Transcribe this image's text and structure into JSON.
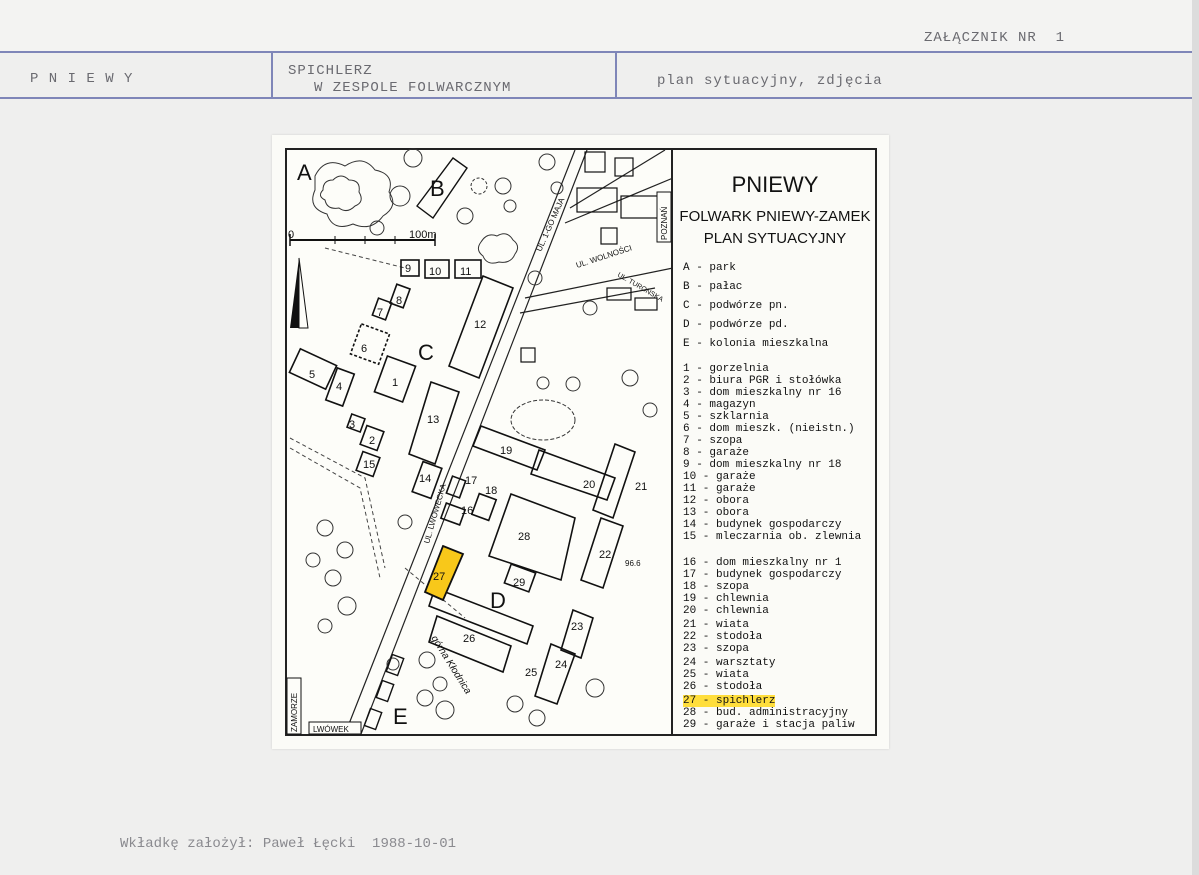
{
  "header": {
    "attachment": "ZAŁĄCZNIK NR  1",
    "locality": "P N I E W Y",
    "object_line1": "SPICHLERZ",
    "object_line2": "W ZESPOLE FOLWARCZNYM",
    "contents": "plan sytuacyjny, zdjęcia"
  },
  "map": {
    "title1": "PNIEWY",
    "title2": "FOLWARK PNIEWY-ZAMEK",
    "title3": "PLAN SYTUACYJNY",
    "scale_zero": "0",
    "scale_end": "100m",
    "zones": [
      "A",
      "B",
      "C",
      "D",
      "E"
    ],
    "streets": {
      "s1": "UL. 1-GO MAJA",
      "s2": "UL. WOLNOŚCI",
      "s3": "UL. TURONSKA",
      "s4": "UL. LWOWECKA",
      "s5": "górna Kłodnica"
    },
    "roads": {
      "poznan": "POZNAŃ",
      "zamorze": "ZAMORZE",
      "lwowek": "LWÓWEK"
    },
    "elevation": "96.6",
    "buildings": [
      "1",
      "2",
      "3",
      "4",
      "5",
      "6",
      "7",
      "8",
      "9",
      "10",
      "11",
      "12",
      "13",
      "14",
      "15",
      "16",
      "17",
      "18",
      "19",
      "20",
      "21",
      "22",
      "23",
      "24",
      "25",
      "26",
      "27",
      "28",
      "29"
    ],
    "highlight_color": "#f8c81a",
    "legend_zones": [
      "A - park",
      "B - pałac",
      "C - podwórze pn.",
      "D - podwórze pd.",
      "E - kolonia mieszkalna"
    ],
    "legend_buildings": [
      "1 - gorzelnia",
      "2 - biura PGR i stołówka",
      "3 - dom mieszkalny nr 16",
      "4 - magazyn",
      "5 - szklarnia",
      "6 - dom mieszk. (nieistn.)",
      "7 - szopa",
      "8 - garaże",
      "9 - dom mieszkalny nr 18",
      "10 - garaże",
      "11 - garaże",
      "12 - obora",
      "13 - obora",
      "14 - budynek gospodarczy",
      "15 - mleczarnia ob. zlewnia",
      "16 - dom mieszkalny nr 1",
      "17 - budynek gospodarczy",
      "18 - szopa",
      "19 - chlewnia",
      "20 - chlewnia",
      "21 - wiata",
      "22 - stodoła",
      "23 - szopa",
      "24 - warsztaty",
      "25 - wiata",
      "26 - stodoła",
      "27 - spichlerz",
      "28 - bud. administracyjny",
      "29 - garaże i stacja paliw"
    ]
  },
  "footer": "Wkładkę założył: Paweł Łęcki  1988-10-01"
}
